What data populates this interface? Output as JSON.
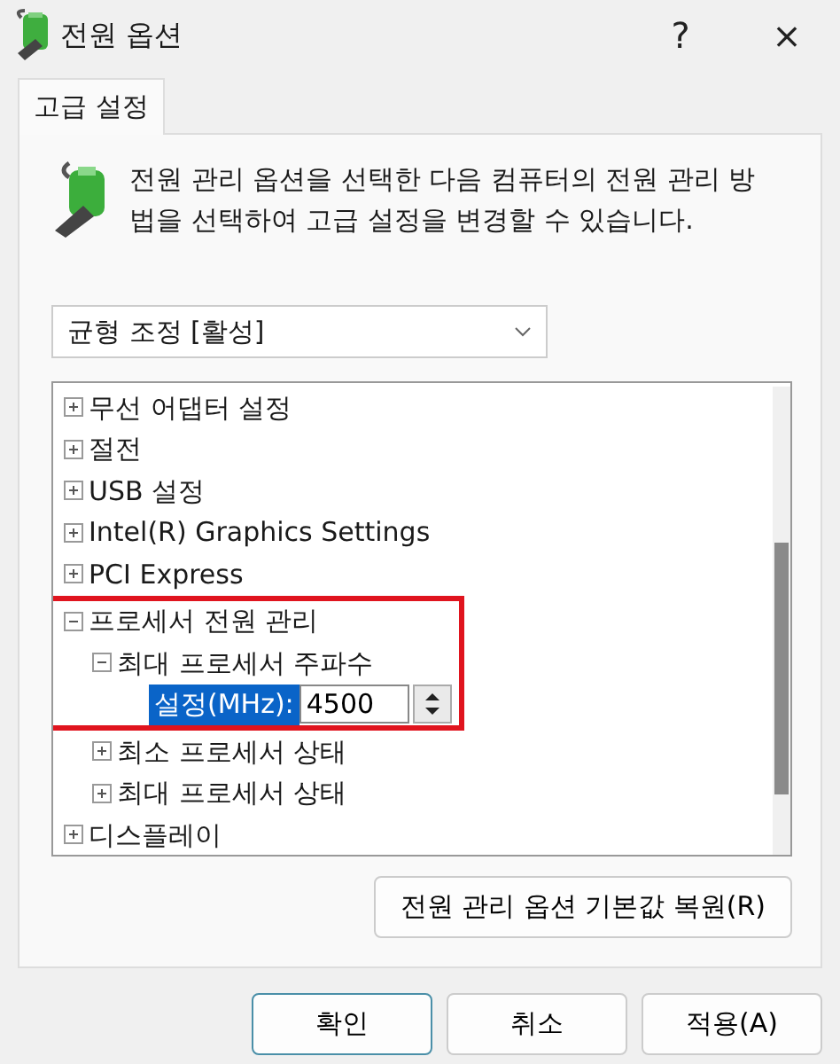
{
  "window": {
    "title": "전원 옵션",
    "help": "?",
    "close": "×"
  },
  "tabs": [
    {
      "label": "고급 설정",
      "selected": true
    }
  ],
  "description": "전원 관리 옵션을 선택한 다음 컴퓨터의 전원 관리 방법을 선택하여 고급 설정을 변경할 수 있습니다.",
  "plan_dropdown": {
    "value": "균형 조정 [활성]"
  },
  "tree": [
    {
      "label": "무선 어댑터 설정",
      "expanded": false,
      "highlighted": false
    },
    {
      "label": "절전",
      "expanded": false,
      "highlighted": false
    },
    {
      "label": "USB 설정",
      "expanded": false,
      "highlighted": false
    },
    {
      "label": "Intel(R) Graphics Settings",
      "expanded": false,
      "highlighted": false
    },
    {
      "label": "PCI Express",
      "expanded": false,
      "highlighted": false
    },
    {
      "label": "프로세서 전원 관리",
      "expanded": true,
      "highlighted": true,
      "children": [
        {
          "label": "최대 프로세서 주파수",
          "expanded": true,
          "highlighted": true,
          "children": [
            {
              "kind": "setting",
              "label": "설정(MHz):",
              "value": "4500",
              "selected": true,
              "highlighted": true
            }
          ]
        },
        {
          "label": "최소 프로세서 상태",
          "expanded": false,
          "highlighted": false
        },
        {
          "label": "최대 프로세서 상태",
          "expanded": false,
          "highlighted": false
        }
      ]
    },
    {
      "label": "디스플레이",
      "expanded": false,
      "highlighted": false
    }
  ],
  "restore_button": "전원 관리 옵션 기본값 복원(R)",
  "buttons": [
    {
      "label": "확인",
      "default": true
    },
    {
      "label": "취소",
      "default": false
    },
    {
      "label": "적용(A)",
      "default": false
    }
  ]
}
